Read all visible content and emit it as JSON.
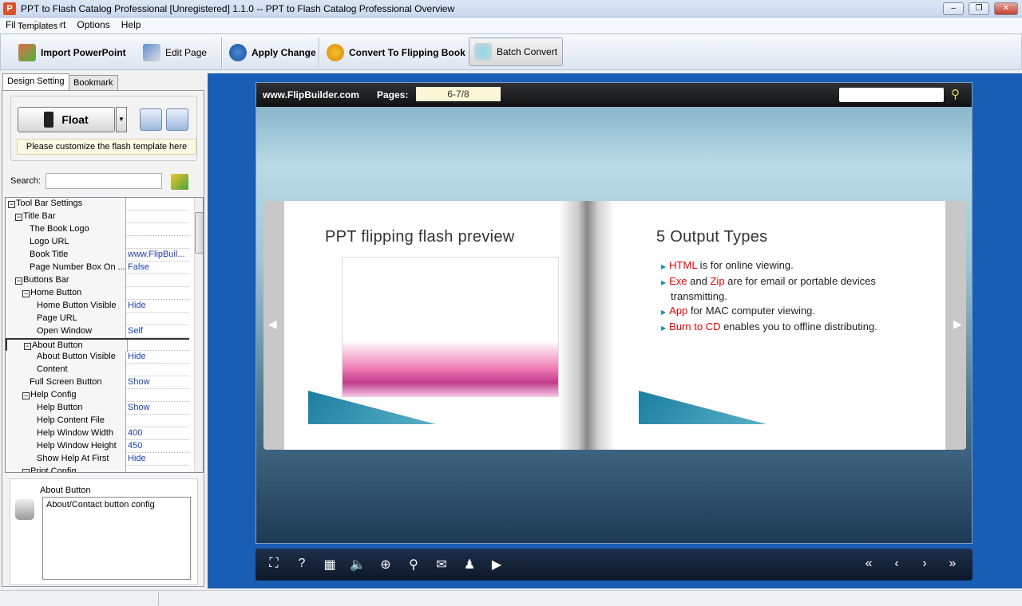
{
  "window": {
    "title": "PPT to Flash Catalog Professional [Unregistered] 1.1.0  -- PPT to Flash Catalog Professional Overview",
    "app_icon": "P"
  },
  "menu": [
    "File",
    "Convert",
    "Options",
    "Help"
  ],
  "toolbar": {
    "import": "Import PowerPoint",
    "edit": "Edit Page",
    "apply": "Apply Change",
    "convert": "Convert To Flipping Book",
    "batch": "Batch Convert"
  },
  "tabs": [
    "Design Setting",
    "Bookmark"
  ],
  "templates": {
    "label": "Templates",
    "selected": "Float",
    "hint": "Please customize the flash template here"
  },
  "search": {
    "label": "Search:",
    "value": ""
  },
  "settings": [
    {
      "k": "Tool Bar Settings",
      "v": "",
      "lvl": 0,
      "box": true
    },
    {
      "k": "Title Bar",
      "v": "",
      "lvl": 1,
      "box": true
    },
    {
      "k": "The Book Logo",
      "v": "",
      "lvl": 3
    },
    {
      "k": "Logo URL",
      "v": "",
      "lvl": 3
    },
    {
      "k": "Book Title",
      "v": "www.FlipBuil...",
      "lvl": 3
    },
    {
      "k": "Page Number Box On ...",
      "v": "False",
      "lvl": 3
    },
    {
      "k": "Buttons Bar",
      "v": "",
      "lvl": 1,
      "box": true
    },
    {
      "k": "Home Button",
      "v": "",
      "lvl": 2,
      "box": true
    },
    {
      "k": "Home Button Visible",
      "v": "Hide",
      "lvl": 4
    },
    {
      "k": "Page URL",
      "v": "",
      "lvl": 4
    },
    {
      "k": "Open Window",
      "v": "Self",
      "lvl": 4
    },
    {
      "k": "About Button",
      "v": "",
      "lvl": 2,
      "box": true,
      "sel": true
    },
    {
      "k": "About Button Visible",
      "v": "Hide",
      "lvl": 4
    },
    {
      "k": "Content",
      "v": "",
      "lvl": 4
    },
    {
      "k": "Full Screen Button",
      "v": "Show",
      "lvl": 3
    },
    {
      "k": "Help Config",
      "v": "",
      "lvl": 2,
      "box": true
    },
    {
      "k": "Help Button",
      "v": "Show",
      "lvl": 4
    },
    {
      "k": "Help Content File",
      "v": "",
      "lvl": 4
    },
    {
      "k": "Help Window Width",
      "v": "400",
      "lvl": 4
    },
    {
      "k": "Help Window Height",
      "v": "450",
      "lvl": 4
    },
    {
      "k": "Show Help At First",
      "v": "Hide",
      "lvl": 4
    },
    {
      "k": "Print Config",
      "v": "",
      "lvl": 2,
      "box": true
    }
  ],
  "description": {
    "title": "About Button",
    "text": "About/Contact button config"
  },
  "viewer": {
    "site": "www.FlipBuilder.com",
    "pages_label": "Pages:",
    "pages_value": "6-7/8",
    "left_title": "PPT flipping flash preview",
    "right_title": "5 Output Types",
    "bullets": [
      {
        "red": "HTML",
        "rest": " is for online viewing."
      },
      {
        "red": "Exe",
        "mid": " and ",
        "red2": "Zip",
        "rest": " are for email or portable devices transmitting."
      },
      {
        "red": "App",
        "rest": " for MAC computer viewing."
      },
      {
        "red": "Burn to CD",
        "rest": " enables you to offline distributing."
      }
    ]
  },
  "colors": {
    "workspace": "#1a5db5",
    "accent_red": "#e00000"
  }
}
